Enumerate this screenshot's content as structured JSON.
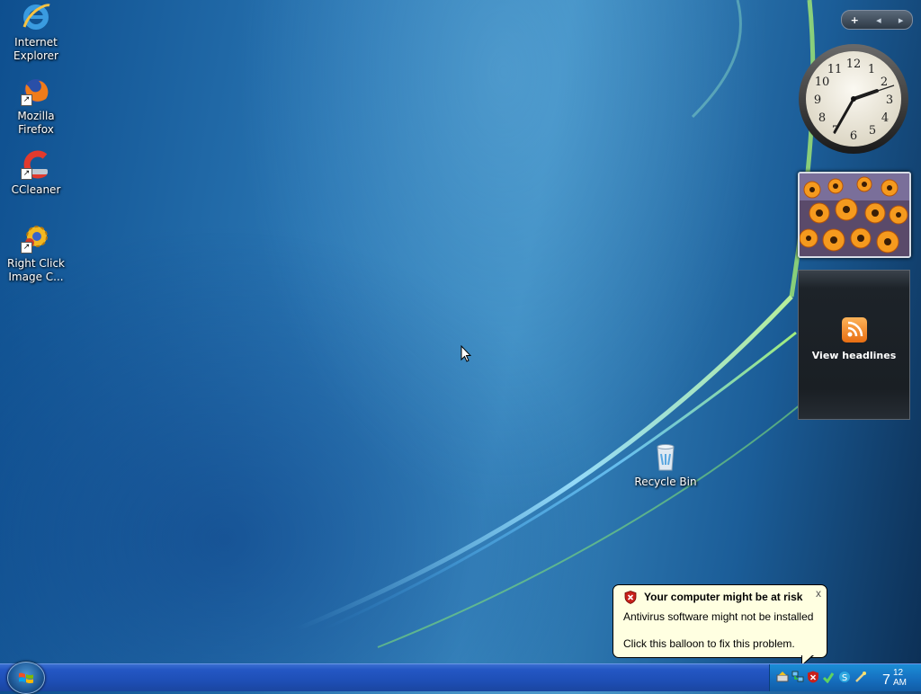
{
  "desktop": {
    "icons": [
      {
        "label_line1": "Internet",
        "label_line2": "Explorer",
        "icon": "internet-explorer-icon"
      },
      {
        "label_line1": "Mozilla",
        "label_line2": "Firefox",
        "icon": "firefox-icon"
      },
      {
        "label_line1": "CCleaner",
        "label_line2": "",
        "icon": "ccleaner-icon"
      },
      {
        "label_line1": "Right Click",
        "label_line2": "Image C...",
        "icon": "gear-icon"
      }
    ],
    "recycle_bin": {
      "label": "Recycle Bin",
      "icon": "recycle-bin-icon"
    }
  },
  "sidebar": {
    "controls": {
      "add": "+",
      "prev": "◂",
      "next": "▸"
    },
    "clock": {
      "numerals": [
        "12",
        "1",
        "2",
        "3",
        "4",
        "5",
        "6",
        "7",
        "8",
        "9",
        "10",
        "11"
      ],
      "hour_hand_time": "2:37"
    },
    "feed": {
      "label": "View headlines",
      "icon": "rss-icon"
    }
  },
  "balloon": {
    "title": "Your computer might be at risk",
    "line1": "Antivirus software might not be installed",
    "line2": "Click this balloon to fix this problem.",
    "close": "x",
    "icon": "security-shield-icon"
  },
  "taskbar": {
    "clock": {
      "hour": "7",
      "minute": "12",
      "ampm": "AM"
    }
  },
  "colors": {
    "taskbar": "#1e4fb6",
    "tray": "#1672c2",
    "balloon": "#ffffe1"
  }
}
